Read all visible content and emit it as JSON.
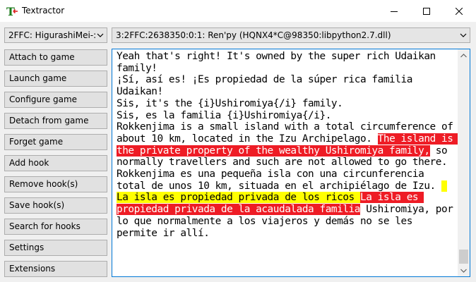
{
  "window": {
    "title": "Textractor",
    "icon": "textractor-t-icon",
    "controls": [
      "minimize-icon",
      "maximize-icon",
      "close-icon"
    ]
  },
  "process_select": {
    "value": "2FFC: HigurashiMei-:"
  },
  "hook_select": {
    "value": "3:2FFC:2638350:0:1: Ren'py (HQNX4*C@98350:libpython2.7.dll)"
  },
  "sidebar": {
    "buttons": [
      "Attach to game",
      "Launch game",
      "Configure game",
      "Detach from game",
      "Forget game",
      "Add hook",
      "Remove hook(s)",
      "Save hook(s)",
      "Search for hooks",
      "Settings",
      "Extensions"
    ]
  },
  "output": {
    "segments": [
      "Yeah that's right! It's owned by the super rich Udaikan family!\n¡Sí, así es! ¡Es propiedad de la súper rica familia Udaikan!\nSis, it's the {i}Ushiromiya{/i} family.\nSis, es la familia {i}Ushiromiya{/i}.\nRokkenjima is a small island with a total circumference of about 10 km, located in the Izu Archipelago. ",
      "The island is the private property of the wealthy Ushiromiya family,",
      " so normally travellers and such are not allowed to go there.\nRokkenjima es una pequeña isla con una circunferencia total de unos 10 km, situada en el archipiélago de Izu. ",
      " La isla es propiedad privada de los ricos ",
      "La isla es propiedad privada de la acaudalada familia",
      " Ushiromiya, por lo que normalmente a los viajeros y demás no se les permite ir allí."
    ],
    "highlight_colors": {
      "red": "#ee1c25",
      "yellow": "#ffff00"
    }
  },
  "colors": {
    "accent_border": "#0078d7",
    "button_face": "#e1e1e1",
    "window_bg": "#f0f0f0"
  }
}
